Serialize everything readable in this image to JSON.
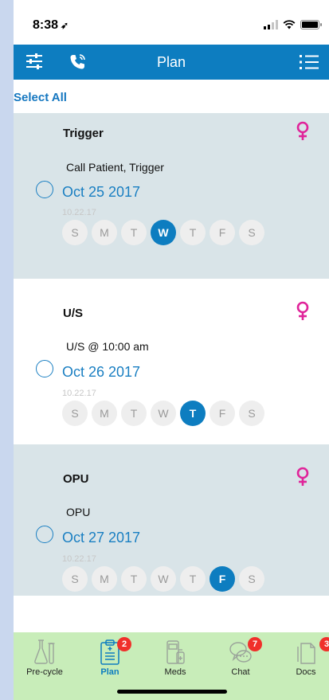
{
  "status_bar": {
    "time": "8:38",
    "location_glyph": "➶"
  },
  "nav": {
    "title": "Plan",
    "left_icons": [
      "sliders-icon",
      "phone-icon"
    ],
    "right_icon": "list-icon"
  },
  "select_all": "Select All",
  "colors": {
    "accent": "#0d7dc0",
    "card_shade": "#d9e4e8",
    "female_icon": "#e0249a",
    "tab_bar": "#c8edb9",
    "badge": "#f0302b"
  },
  "cards": [
    {
      "title": "Trigger",
      "description": "Call Patient, Trigger",
      "date": "Oct 25 2017",
      "sub": "10.22.17",
      "days": [
        "S",
        "M",
        "T",
        "W",
        "T",
        "F",
        "S"
      ],
      "active_day_index": 3,
      "shaded": true
    },
    {
      "title": "U/S",
      "description": "U/S @ 10:00 am",
      "date": "Oct 26 2017",
      "sub": "10.22.17",
      "days": [
        "S",
        "M",
        "T",
        "W",
        "T",
        "F",
        "S"
      ],
      "active_day_index": 4,
      "shaded": false
    },
    {
      "title": "OPU",
      "description": "OPU",
      "date": "Oct 27 2017",
      "sub": "10.22.17",
      "days": [
        "S",
        "M",
        "T",
        "W",
        "T",
        "F",
        "S"
      ],
      "active_day_index": 5,
      "shaded": true
    }
  ],
  "tabs": [
    {
      "label": "Pre-cycle",
      "icon": "flask-icon",
      "badge": ""
    },
    {
      "label": "Plan",
      "icon": "clipboard-icon",
      "badge": "2",
      "active": true
    },
    {
      "label": "Meds",
      "icon": "medication-icon",
      "badge": ""
    },
    {
      "label": "Chat",
      "icon": "chat-icon",
      "badge": "7"
    },
    {
      "label": "Docs",
      "icon": "documents-icon",
      "badge": "3"
    }
  ]
}
